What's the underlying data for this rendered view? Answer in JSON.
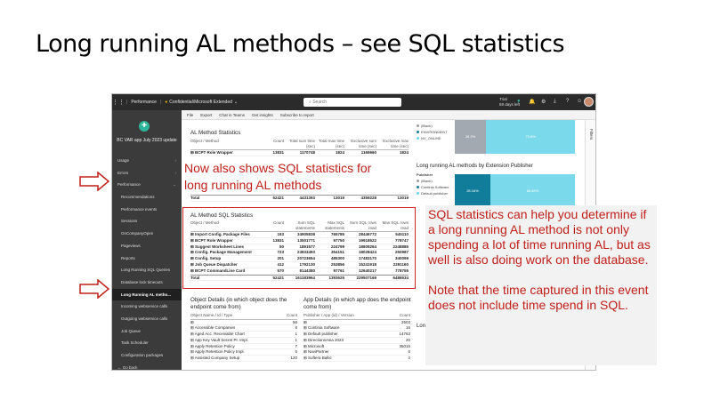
{
  "slide": {
    "title": "Long running AL methods – see SQL statistics"
  },
  "topbar": {
    "app_name": "Performance",
    "sensitivity": "Confidential\\Microsoft Extended",
    "search_placeholder": "Search",
    "trial_label": "Trial",
    "trial_days": "59 days left"
  },
  "toolbar": {
    "items": [
      "File",
      "Export",
      "Chat in Teams",
      "Get insights",
      "Subscribe to report"
    ]
  },
  "filters_label": "Filters",
  "sidebar": {
    "workspace_name": "BC VAR app July 2023 update",
    "items": [
      {
        "label": "Usage"
      },
      {
        "label": "Errors"
      },
      {
        "label": "Performance"
      },
      {
        "label": "Recommendations"
      },
      {
        "label": "Performance events"
      },
      {
        "label": "Sessions"
      },
      {
        "label": "OnCompanyOpen"
      },
      {
        "label": "Pageviews"
      },
      {
        "label": "Reports"
      },
      {
        "label": "Long Running SQL Queries"
      },
      {
        "label": "Database lock timeouts"
      },
      {
        "label": "Long Running AL metho..."
      },
      {
        "label": "Incoming webservice calls"
      },
      {
        "label": "Outgoing webservice calls"
      },
      {
        "label": "Job Queue"
      },
      {
        "label": "Task Scheduler"
      },
      {
        "label": "Configuration packages"
      },
      {
        "label": "Go back"
      }
    ]
  },
  "al_stats": {
    "title": "AL Method Statistics",
    "columns": [
      "Object / Method",
      "Count",
      "Total sum time (sec)",
      "Total max time (sec)",
      "Exclusive sum time (sec)",
      "Exclusive max time (sec)"
    ],
    "rows": [
      [
        "BCPT Role Wrapper",
        "13831",
        "1170748",
        "1824",
        "1169960",
        "1824"
      ]
    ],
    "total": [
      "Total",
      "52421",
      "4431393",
      "13019",
      "4359228",
      "13019"
    ]
  },
  "sql_stats": {
    "title": "AL Method SQL Statistics",
    "columns": [
      "Object / Method",
      "Count",
      "Sum SQL statements",
      "Max SQL statements",
      "Sum SQL rows read",
      "Max SQL rows read"
    ],
    "rows": [
      [
        "Import Config. Package Files",
        "163",
        "34905838",
        "765785",
        "28446772",
        "545110"
      ],
      [
        "BCPT Role Wrapper",
        "13831",
        "13501771",
        "97750",
        "19918522",
        "778747"
      ],
      [
        "Suggest Worksheet Lines",
        "50",
        "1891577",
        "224799",
        "18809264",
        "2248885"
      ],
      [
        "Config. Package Management",
        "723",
        "23833493",
        "354151",
        "18028424",
        "250987"
      ],
      [
        "Config. Setup",
        "201",
        "20723654",
        "485300",
        "17483170",
        "340099"
      ],
      [
        "Job Queue Dispatcher",
        "412",
        "1792130",
        "253856",
        "15241918",
        "2291160"
      ],
      [
        "BCPT CommandLine Card",
        "570",
        "8144380",
        "97761",
        "12640217",
        "778755"
      ]
    ],
    "total": [
      "Total",
      "52421",
      "161183964",
      "1393625",
      "229507169",
      "6486534"
    ]
  },
  "object_details": {
    "title": "Object Details (in which object does the endpoint come from)",
    "columns": [
      "Object Name / Id / Type",
      "Count"
    ],
    "rows": [
      [
        "",
        "56"
      ],
      [
        "Accessible Companies",
        "8"
      ],
      [
        "Aged Acc. Receivable Chart",
        "1"
      ],
      [
        "App Key Vault Secret Pr. Impl.",
        "1"
      ],
      [
        "Apply Retention Policy",
        "7"
      ],
      [
        "Apply Retention Policy Impl.",
        "5"
      ],
      [
        "Assisted Company Setup",
        "120"
      ]
    ]
  },
  "app_details": {
    "title": "App Details (in which app does the endpoint come from)",
    "columns": [
      "Publisher / App (id) / Version",
      "Count"
    ],
    "rows": [
      [
        "",
        "2603"
      ],
      [
        "Continia Software",
        "16"
      ],
      [
        "Default publisher",
        "14763"
      ],
      [
        "DirectionsAsia 2023",
        "20"
      ],
      [
        "Microsoft",
        "35015"
      ],
      [
        "NaviPartner",
        "5"
      ],
      [
        "Softera Baltic",
        "2"
      ]
    ]
  },
  "right_panel": {
    "legend_top": [
      "(Blank)",
      "ENVIRONMENT",
      "NV_ONLINE"
    ],
    "bar_top_left_label": "26.2%",
    "bar_top_right_label": "73.8%",
    "chart_title": "Long running AL methods by Extension Publisher",
    "publisher_label": "Publisher",
    "legend_pub": [
      "(Blank)",
      "Continia Software",
      "Default publisher"
    ],
    "bar_mid_left_label": "28.16%",
    "bar_mid_right_label": "66.89%",
    "lower_title": "Long"
  },
  "callouts": {
    "left": [
      "Now also shows SQL statistics for",
      "long running AL methods"
    ],
    "right_p1": "SQL statistics can help you determine if a long running AL method is not only spending a lot of time running AL, but as well is also doing work on the database.",
    "right_p2": "Note that the time captured in this event does not include time spend in SQL."
  }
}
